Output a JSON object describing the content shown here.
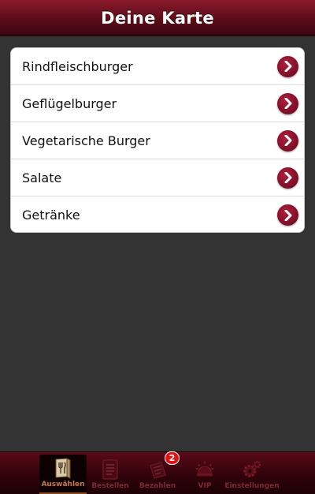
{
  "header": {
    "title": "Deine Karte"
  },
  "menu": {
    "items": [
      {
        "label": "Rindfleischburger"
      },
      {
        "label": "Geflügelburger"
      },
      {
        "label": "Vegetarische Burger"
      },
      {
        "label": "Salate"
      },
      {
        "label": "Getränke"
      }
    ]
  },
  "tabbar": {
    "tabs": [
      {
        "label": "Auswählen",
        "icon": "menu-book-icon",
        "active": true
      },
      {
        "label": "Bestellen",
        "icon": "order-list-icon"
      },
      {
        "label": "Bezahlen",
        "icon": "payment-icon",
        "badge": "2"
      },
      {
        "label": "VIP",
        "icon": "service-bell-icon"
      },
      {
        "label": "Einstellungen",
        "icon": "gears-icon"
      }
    ]
  },
  "colors": {
    "header_top": "#8a1a2c",
    "header_bottom": "#3a0510",
    "accent": "#7a0d24",
    "background": "#333333",
    "badge": "#e01414"
  }
}
